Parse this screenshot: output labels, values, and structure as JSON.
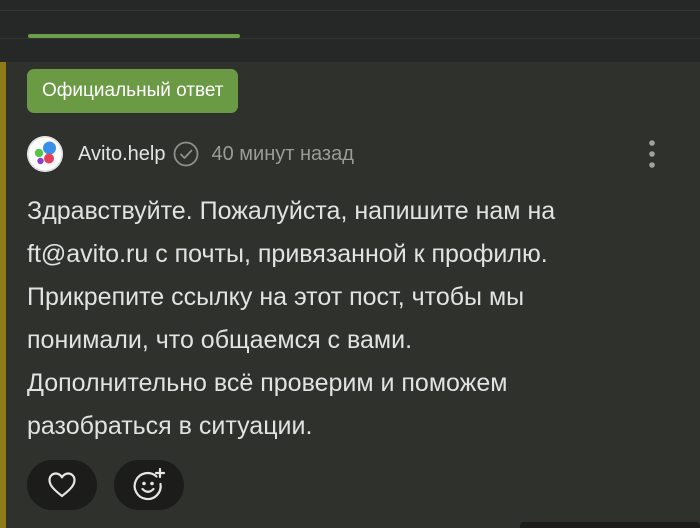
{
  "badge": {
    "label": "Официальный ответ"
  },
  "comment": {
    "author": "Avito.help",
    "time": "40 минут назад",
    "text_lines": [
      "Здравствуйте. Пожалуйста, напишите нам на",
      "ft@avito.ru с почты, привязанной к профилю.",
      "Прикрепите ссылку на этот пост, чтобы мы",
      "понимали, что общаемся с вами.",
      "Дополнительно всё проверим и поможем",
      "разобраться в ситуации."
    ]
  },
  "icons": {
    "avatar": "avito-logo",
    "verified": "check-circle-icon",
    "more": "more-vertical-icon",
    "like": "heart-icon",
    "react": "smile-plus-icon"
  },
  "colors": {
    "badge_bg": "#6a9a44",
    "accent_bar": "#8e7b18",
    "tab_indicator": "#6e9d4a",
    "background": "#2f312d"
  }
}
